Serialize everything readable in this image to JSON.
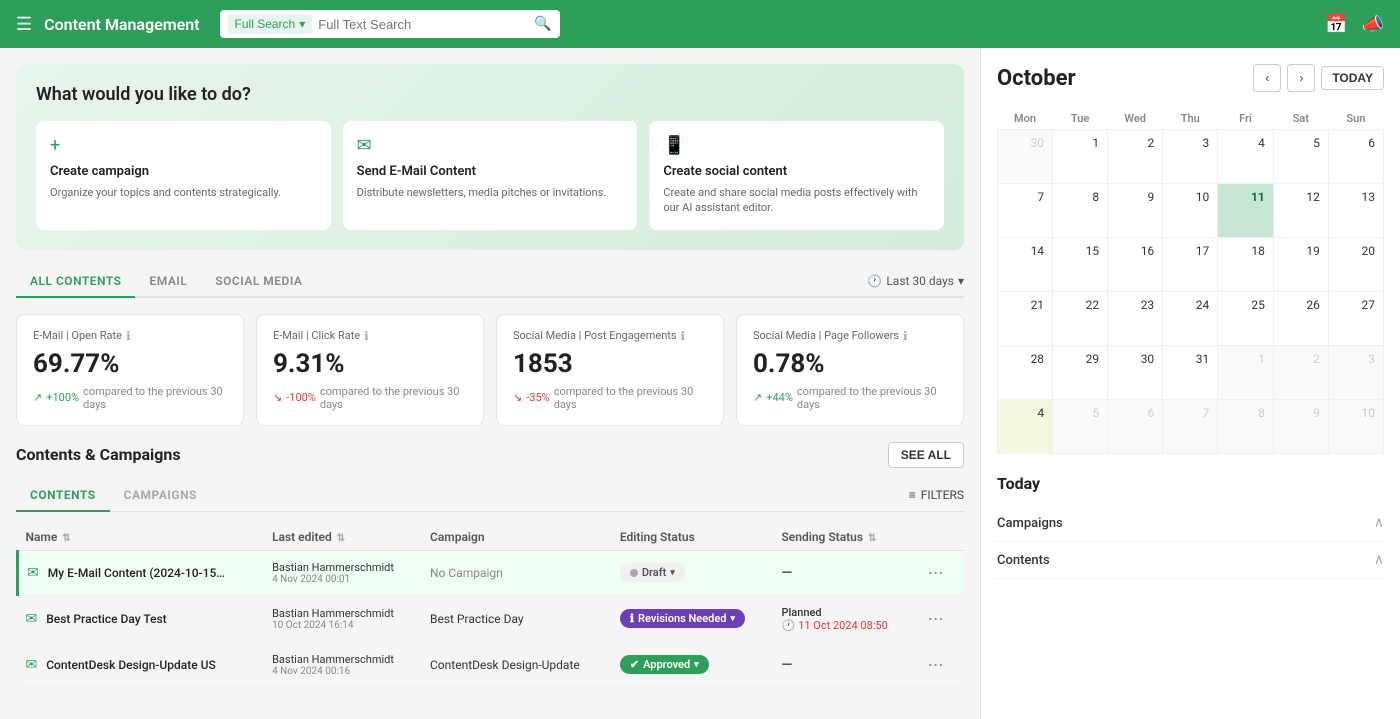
{
  "topnav": {
    "title": "Content Management",
    "search_placeholder": "Full Text Search",
    "dropdown_label": "Full Search",
    "icons": {
      "calendar": "📅",
      "megaphone": "📣"
    }
  },
  "welcome": {
    "heading": "What would you like to do?",
    "actions": [
      {
        "icon": "+",
        "title": "Create campaign",
        "desc": "Organize your topics and contents strategically."
      },
      {
        "icon": "✉",
        "title": "Send E-Mail Content",
        "desc": "Distribute newsletters, media pitches or invitations."
      },
      {
        "icon": "📱",
        "title": "Create social content",
        "desc": "Create and share social media posts effectively with our AI assistant editor."
      }
    ]
  },
  "tabs": {
    "items": [
      {
        "label": "ALL CONTENTS",
        "active": true
      },
      {
        "label": "EMAIL",
        "active": false
      },
      {
        "label": "SOCIAL MEDIA",
        "active": false
      }
    ],
    "filter_label": "Last 30 days"
  },
  "stats": [
    {
      "label": "E-Mail | Open Rate",
      "value": "69.77%",
      "change": "+100%",
      "change_dir": "up",
      "change_label": "compared to the previous 30 days"
    },
    {
      "label": "E-Mail | Click Rate",
      "value": "9.31%",
      "change": "-100%",
      "change_dir": "down",
      "change_label": "compared to the previous 30 days"
    },
    {
      "label": "Social Media | Post Engagements",
      "value": "1853",
      "change": "-35%",
      "change_dir": "down",
      "change_label": "compared to the previous 30 days"
    },
    {
      "label": "Social Media | Page Followers",
      "value": "0.78%",
      "change": "+44%",
      "change_dir": "up",
      "change_label": "compared to the previous 30 days"
    }
  ],
  "contents_campaigns": {
    "title": "Contents & Campaigns",
    "see_all_label": "SEE ALL",
    "sub_tabs": [
      {
        "label": "CONTENTS",
        "active": true
      },
      {
        "label": "CAMPAIGNS",
        "active": false
      }
    ],
    "filters_label": "FILTERS",
    "table": {
      "headers": [
        "Name",
        "Last edited",
        "Campaign",
        "Editing Status",
        "Sending Status"
      ],
      "rows": [
        {
          "icon": "✉",
          "name": "My E-Mail Content (2024-10-15…",
          "editor": "Bastian Hammerschmidt",
          "date": "4 Nov 2024 00:01",
          "campaign": "No Campaign",
          "no_campaign": true,
          "editing_status": "Draft",
          "editing_status_type": "draft",
          "sending_status": "—",
          "sending_type": "dash",
          "highlight": true
        },
        {
          "icon": "✉",
          "name": "Best Practice Day Test",
          "editor": "Bastian Hammerschmidt",
          "date": "10 Oct 2024 16:14",
          "campaign": "Best Practice Day",
          "no_campaign": false,
          "editing_status": "Revisions Needed",
          "editing_status_type": "revisions",
          "sending_status": "Planned",
          "sending_type": "planned",
          "sending_time": "11 Oct 2024 08:50",
          "highlight": false
        },
        {
          "icon": "✉",
          "name": "ContentDesk Design-Update US",
          "editor": "Bastian Hammerschmidt",
          "date": "4 Nov 2024 00:16",
          "campaign": "ContentDesk Design-Update",
          "no_campaign": false,
          "editing_status": "Approved",
          "editing_status_type": "approved",
          "sending_status": "—",
          "sending_type": "dash",
          "highlight": false
        }
      ]
    }
  },
  "calendar": {
    "month": "October",
    "nav": {
      "prev": "‹",
      "next": "›",
      "today": "TODAY"
    },
    "days_of_week": [
      "Mon",
      "Tue",
      "Wed",
      "Thu",
      "Fri",
      "Sat",
      "Sun"
    ],
    "weeks": [
      [
        {
          "day": "30",
          "other": true
        },
        {
          "day": "1",
          "other": false
        },
        {
          "day": "2",
          "other": false
        },
        {
          "day": "3",
          "other": false
        },
        {
          "day": "4",
          "other": false
        },
        {
          "day": "5",
          "other": false
        },
        {
          "day": "6",
          "other": false
        }
      ],
      [
        {
          "day": "7",
          "other": false
        },
        {
          "day": "8",
          "other": false
        },
        {
          "day": "9",
          "other": false
        },
        {
          "day": "10",
          "other": false
        },
        {
          "day": "11",
          "today": true
        },
        {
          "day": "12",
          "other": false
        },
        {
          "day": "13",
          "other": false
        }
      ],
      [
        {
          "day": "14",
          "other": false
        },
        {
          "day": "15",
          "other": false
        },
        {
          "day": "16",
          "other": false
        },
        {
          "day": "17",
          "other": false
        },
        {
          "day": "18",
          "other": false
        },
        {
          "day": "19",
          "other": false
        },
        {
          "day": "20",
          "other": false
        }
      ],
      [
        {
          "day": "21",
          "other": false
        },
        {
          "day": "22",
          "other": false
        },
        {
          "day": "23",
          "other": false
        },
        {
          "day": "24",
          "other": false
        },
        {
          "day": "25",
          "other": false
        },
        {
          "day": "26",
          "other": false
        },
        {
          "day": "27",
          "other": false
        }
      ],
      [
        {
          "day": "28",
          "other": false
        },
        {
          "day": "29",
          "other": false
        },
        {
          "day": "30",
          "other": false
        },
        {
          "day": "31",
          "other": false
        },
        {
          "day": "1",
          "other": true
        },
        {
          "day": "2",
          "other": true
        },
        {
          "day": "3",
          "other": true
        }
      ],
      [
        {
          "day": "4",
          "highlighted": true
        },
        {
          "day": "5",
          "other": true
        },
        {
          "day": "6",
          "other": true
        },
        {
          "day": "7",
          "other": true
        },
        {
          "day": "8",
          "other": true
        },
        {
          "day": "9",
          "other": true
        },
        {
          "day": "10",
          "other": true
        }
      ]
    ]
  },
  "today_section": {
    "title": "Today",
    "items": [
      {
        "label": "Campaigns"
      },
      {
        "label": "Contents"
      }
    ]
  }
}
